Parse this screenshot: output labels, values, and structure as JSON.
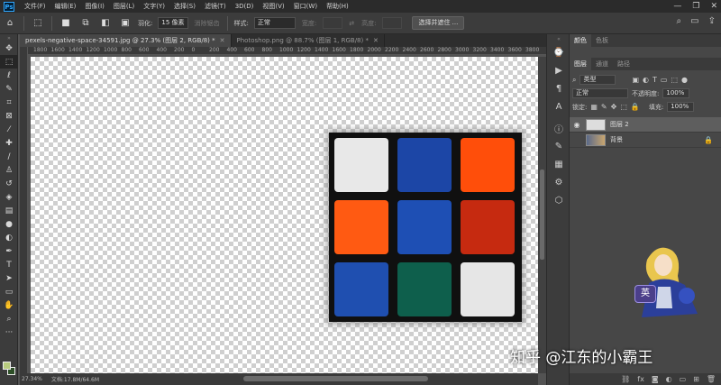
{
  "menubar": {
    "logo": "Ps",
    "items": [
      "文件(F)",
      "编辑(E)",
      "图像(I)",
      "图层(L)",
      "文字(Y)",
      "选择(S)",
      "滤镜(T)",
      "3D(D)",
      "视图(V)",
      "窗口(W)",
      "帮助(H)"
    ],
    "window_controls": [
      "—",
      "❐",
      "✕"
    ]
  },
  "options": {
    "feather_label": "羽化:",
    "feather_value": "15 像素",
    "antialias": "消除锯齿",
    "style_label": "样式:",
    "style_value": "正常",
    "width_label": "宽度:",
    "height_label": "高度:",
    "select_mask_button": "选择并遮住 ..."
  },
  "tabs": [
    {
      "label": "pexels-negative-space-34591.jpg @ 27.3% (图层 2, RGB/8) *"
    },
    {
      "label": "Photoshop.png @ 88.7% (图层 1, RGB/8) *"
    }
  ],
  "ruler": {
    "h_ticks": [
      "1800",
      "1600",
      "1400",
      "1200",
      "1000",
      "800",
      "600",
      "400",
      "200",
      "0",
      "200",
      "400",
      "600",
      "800",
      "1000",
      "1200",
      "1400",
      "1600",
      "1800",
      "2000",
      "2200",
      "2400",
      "2600",
      "2800",
      "3000",
      "3200",
      "3400",
      "3600",
      "3800"
    ]
  },
  "status": {
    "zoom": "27.34%",
    "doc": "文档:17.8M/64.6M"
  },
  "cube": {
    "tile_colors": [
      "#e8e8e8",
      "#1c46a6",
      "#ff4e0a",
      "#ff5a12",
      "#1e4fb4",
      "#c62a10",
      "#1f4fb0",
      "#0e5f4c",
      "#e6e6e6"
    ]
  },
  "panels": {
    "top_tabs": [
      "颜色",
      "色板"
    ],
    "layer_tabs": [
      "图层",
      "通道",
      "路径"
    ],
    "filter_label": "类型",
    "blend_mode": "正常",
    "opacity_label": "不透明度:",
    "opacity_value": "100%",
    "lock_label": "锁定:",
    "fill_label": "填充:",
    "fill_value": "100%",
    "layers": [
      {
        "name": "图层 2",
        "selected": true
      },
      {
        "name": "背景",
        "selected": false
      }
    ]
  },
  "ime": "英",
  "watermark": "知乎 @江东的小霸王"
}
